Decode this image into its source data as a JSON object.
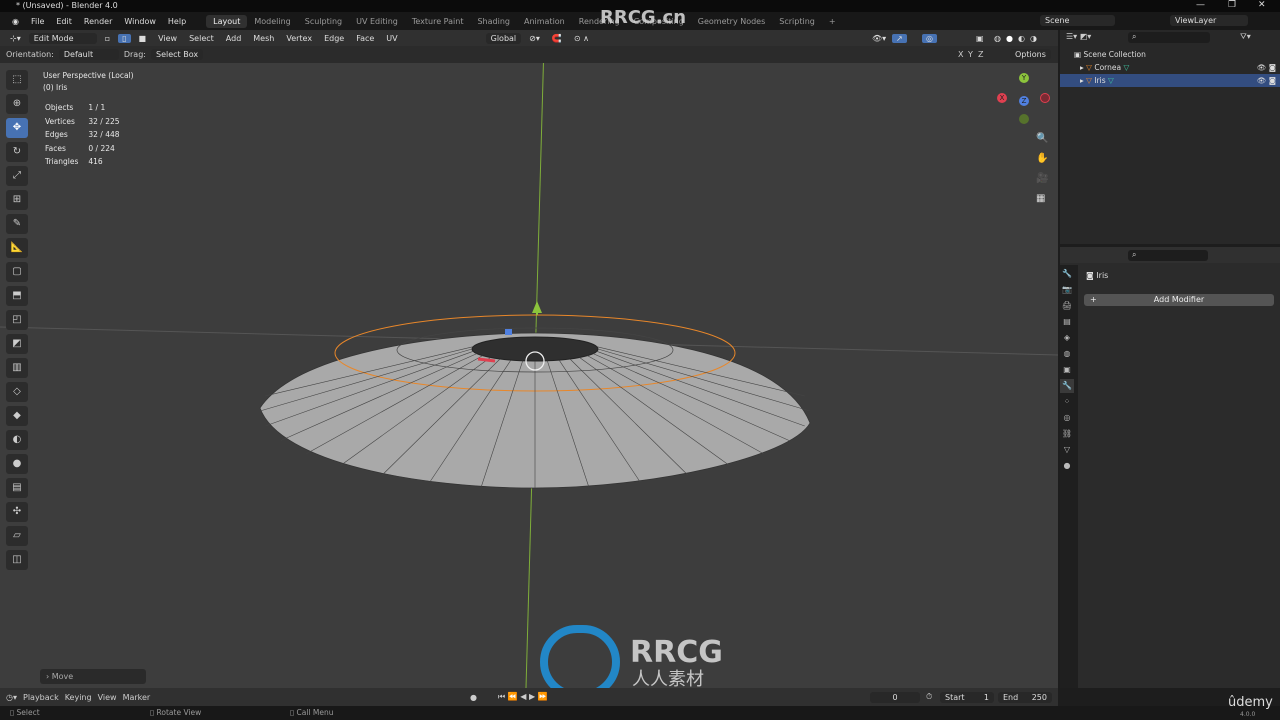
{
  "window": {
    "title": "* (Unsaved) - Blender 4.0",
    "minimize": "—",
    "maximize": "❐",
    "close": "✕"
  },
  "menubar": {
    "items": [
      "File",
      "Edit",
      "Render",
      "Window",
      "Help"
    ],
    "workspaces": [
      "Layout",
      "Modeling",
      "Sculpting",
      "UV Editing",
      "Texture Paint",
      "Shading",
      "Animation",
      "Rendering",
      "Compositing",
      "Geometry Nodes",
      "Scripting"
    ],
    "active_workspace": "Layout",
    "add_workspace": "+",
    "scene": "Scene",
    "view_layer": "ViewLayer"
  },
  "header": {
    "mode": "Edit Mode",
    "menus": [
      "View",
      "Select",
      "Add",
      "Mesh",
      "Vertex",
      "Edge",
      "Face",
      "UV"
    ],
    "transform_orientation": "Global"
  },
  "tool_settings": {
    "orientation_label": "Orientation:",
    "orientation": "Default",
    "drag_label": "Drag:",
    "drag": "Select Box",
    "axes": [
      "X",
      "Y",
      "Z"
    ],
    "options": "Options"
  },
  "viewport": {
    "view_name": "User Perspective (Local)",
    "object_name": "(0) Iris",
    "stats": [
      {
        "label": "Objects",
        "value": "1 / 1"
      },
      {
        "label": "Vertices",
        "value": "32 / 225"
      },
      {
        "label": "Edges",
        "value": "32 / 448"
      },
      {
        "label": "Faces",
        "value": "0 / 224"
      },
      {
        "label": "Triangles",
        "value": "416"
      }
    ],
    "last_operator": "Move",
    "gizmo_axes": [
      "Y",
      "X",
      "Z"
    ]
  },
  "toolbar": {
    "tools": [
      "select-box",
      "cursor",
      "move",
      "rotate",
      "scale",
      "transform",
      "annotate",
      "measure",
      "add-cube",
      "extrude",
      "inset",
      "bevel",
      "loop-cut",
      "knife",
      "poly-build",
      "spin",
      "smooth",
      "edge-slide",
      "shrink-fatten",
      "shear",
      "rip"
    ],
    "active": "move"
  },
  "outliner": {
    "collection": "Scene Collection",
    "items": [
      {
        "name": "Cornea",
        "selected": false
      },
      {
        "name": "Iris",
        "selected": true
      }
    ]
  },
  "properties": {
    "object": "Iris",
    "add_modifier": "Add Modifier"
  },
  "timeline": {
    "menus": [
      "Playback",
      "Keying",
      "View",
      "Marker"
    ],
    "current_frame": "0",
    "start_label": "Start",
    "start": "1",
    "end_label": "End",
    "end": "250"
  },
  "statusbar": {
    "hints": [
      "Select",
      "Rotate View",
      "Call Menu"
    ],
    "version": "4.0.0"
  },
  "watermark": {
    "text": "RRCG.cn",
    "logo_text": "RRCG",
    "logo_sub": "人人素材",
    "udemy": "ûdemy"
  },
  "colors": {
    "accent": "#4772b3",
    "selection": "#ff8c28",
    "y_axis": "#8cc43c",
    "x_axis": "#e04050",
    "z_axis": "#5080e0"
  }
}
